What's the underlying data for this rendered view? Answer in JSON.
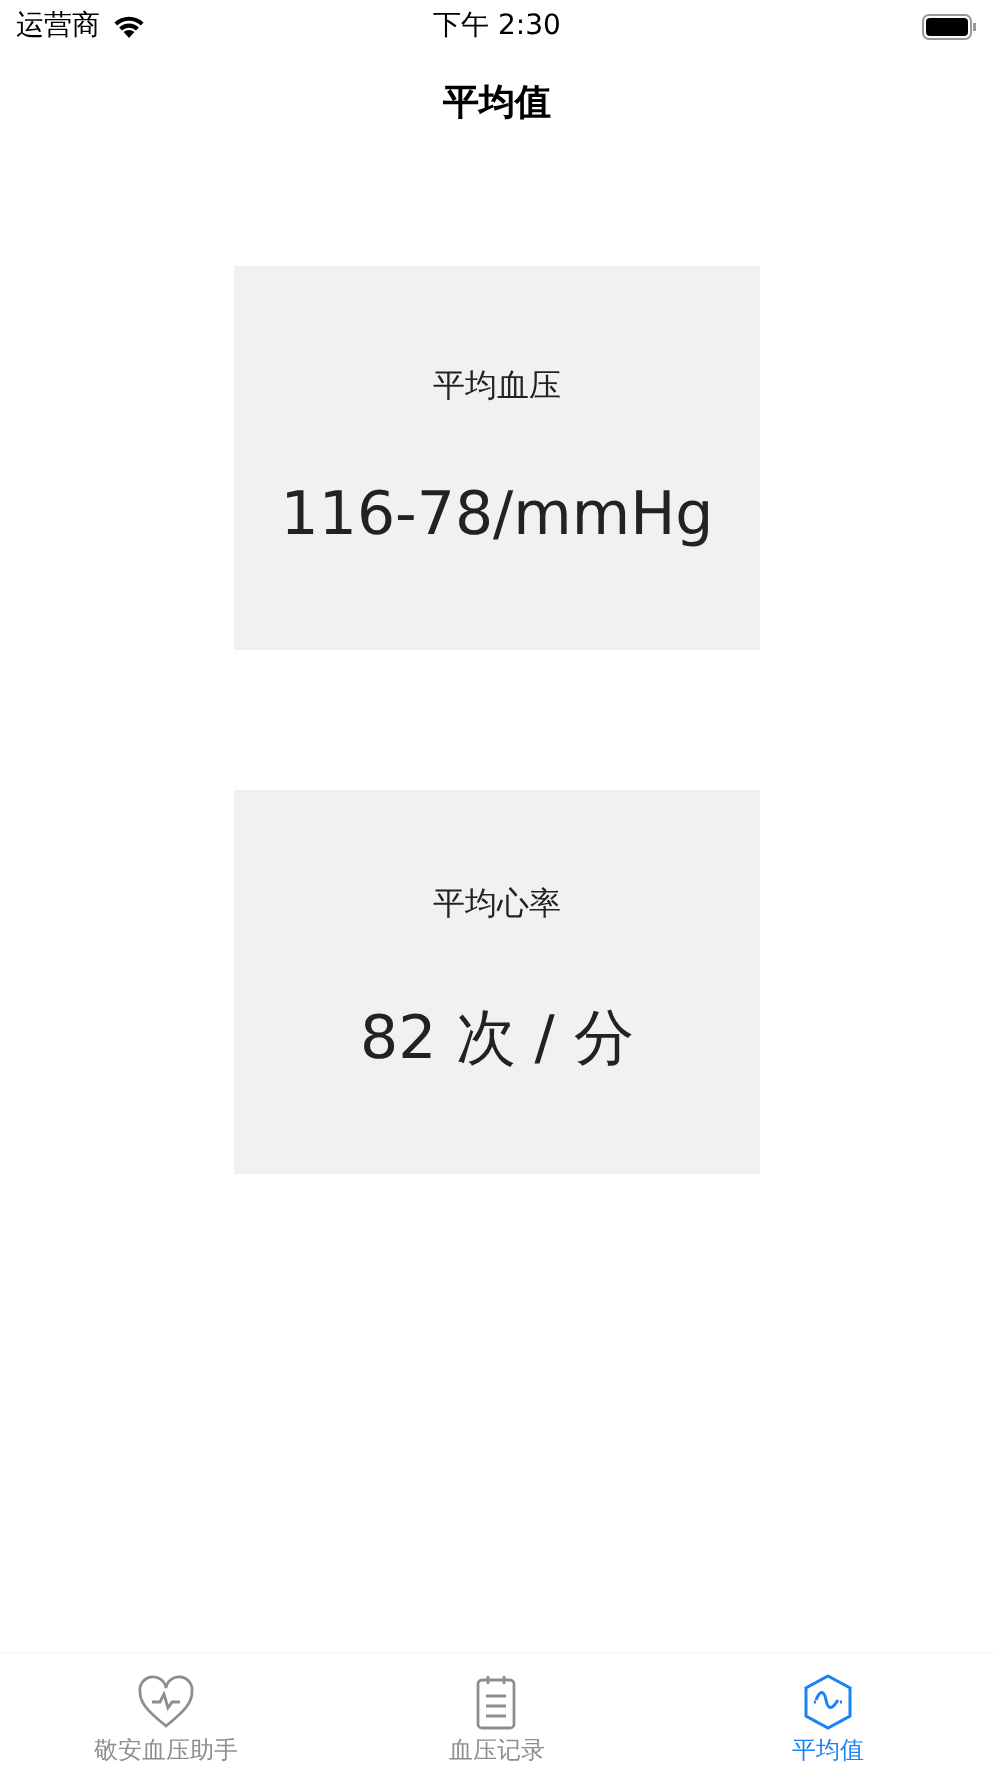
{
  "status_bar": {
    "carrier": "运营商",
    "time": "下午 2:30"
  },
  "nav": {
    "title": "平均值"
  },
  "cards": [
    {
      "label": "平均血压",
      "value": "116-78/mmHg"
    },
    {
      "label": "平均心率",
      "value": "82 次 / 分"
    }
  ],
  "tabs": [
    {
      "kind": "heart",
      "label": "敬安血压助手",
      "selected": false
    },
    {
      "kind": "clipboard",
      "label": "血压记录",
      "selected": false
    },
    {
      "kind": "hexagon",
      "label": "平均值",
      "selected": true
    }
  ]
}
